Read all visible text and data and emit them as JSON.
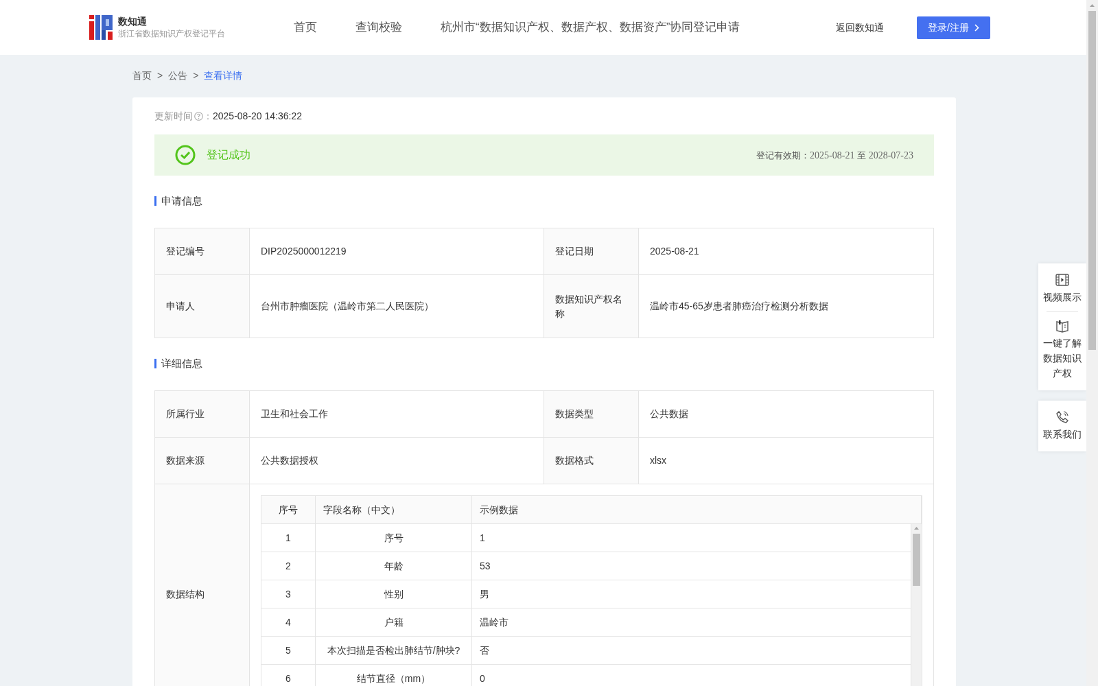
{
  "header": {
    "logo_title": "数知通",
    "logo_subtitle": "浙江省数据知识产权登记平台",
    "nav": [
      "首页",
      "查询校验",
      "杭州市“数据知识产权、数据产权、数据资产”协同登记申请"
    ],
    "back_link": "返回数知通",
    "login_button": "登录/注册"
  },
  "breadcrumb": [
    {
      "label": "首页",
      "current": false
    },
    {
      "label": "公告",
      "current": false
    },
    {
      "label": "查看详情",
      "current": true
    }
  ],
  "breadcrumb_separator": ">",
  "update": {
    "label": "更新时间",
    "colon": "：",
    "value": "2025-08-20 14:36:22"
  },
  "status": {
    "text": "登记成功",
    "validity_label": "登记有效期：",
    "validity_from": "2025-08-21",
    "validity_to_word": "至",
    "validity_to": "2028-07-23"
  },
  "sections": [
    {
      "title": "申请信息",
      "rows": [
        [
          {
            "label": "登记编号",
            "value": "DIP2025000012219"
          },
          {
            "label": "登记日期",
            "value": "2025-08-21"
          }
        ],
        [
          {
            "label": "申请人",
            "value": "台州市肿瘤医院（温岭市第二人民医院）"
          },
          {
            "label": "数据知识产权名称",
            "value": "温岭市45-65岁患者肺癌治疗检测分析数据"
          }
        ]
      ]
    },
    {
      "title": "详细信息",
      "rows": [
        [
          {
            "label": "所属行业",
            "value": "卫生和社会工作"
          },
          {
            "label": "数据类型",
            "value": "公共数据"
          }
        ],
        [
          {
            "label": "数据来源",
            "value": "公共数据授权"
          },
          {
            "label": "数据格式",
            "value": "xlsx"
          }
        ]
      ],
      "structure": {
        "label": "数据结构",
        "columns": [
          "序号",
          "字段名称（中文）",
          "示例数据"
        ],
        "rows": [
          [
            "1",
            "序号",
            "1"
          ],
          [
            "2",
            "年龄",
            "53"
          ],
          [
            "3",
            "性别",
            "男"
          ],
          [
            "4",
            "户籍",
            "温岭市"
          ],
          [
            "5",
            "本次扫描是否检出肺结节/肿块?",
            "否"
          ],
          [
            "6",
            "结节直径（mm）",
            "0"
          ]
        ]
      }
    }
  ],
  "side_panel": [
    {
      "items": [
        "视频展示",
        "一键了解数据知识产权"
      ]
    },
    {
      "items": [
        "联系我们"
      ]
    }
  ]
}
